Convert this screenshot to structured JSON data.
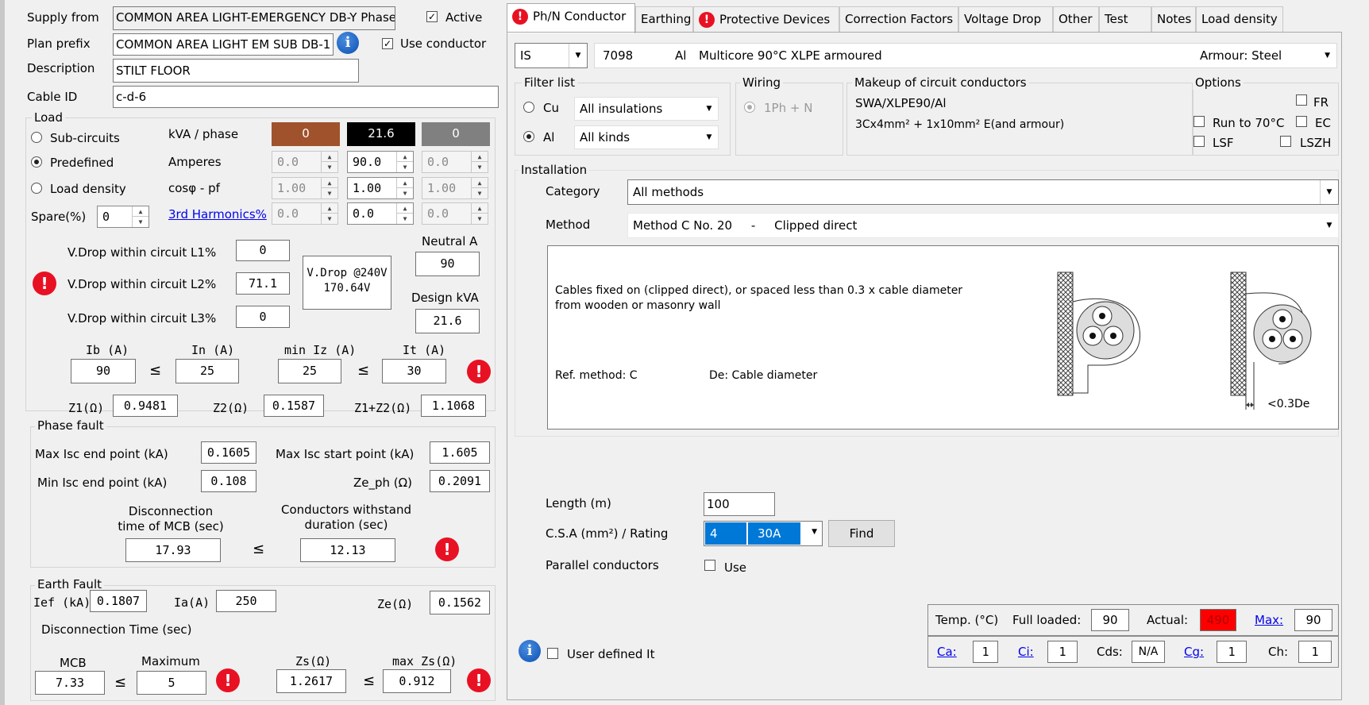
{
  "header": {
    "supply_from_label": "Supply from",
    "supply_from_value": "COMMON AREA LIGHT-EMERGENCY DB-Y Phase",
    "active_label": "Active",
    "plan_prefix_label": "Plan prefix",
    "plan_prefix_value": "COMMON AREA LIGHT EM SUB DB-1",
    "use_conductor_label": "Use conductor",
    "description_label": "Description",
    "description_value": "STILT FLOOR",
    "cable_id_label": "Cable ID",
    "cable_id_value": "c-d-6"
  },
  "load": {
    "title": "Load",
    "radio_sub": "Sub-circuits",
    "radio_predef": "Predefined",
    "radio_density": "Load density",
    "spare_label": "Spare(%)",
    "spare_value": "0",
    "kva_label": "kVA / phase",
    "amps_label": "Amperes",
    "pf_label": "cosφ - pf",
    "harm_label": "3rd Harmonics%",
    "kva": [
      "0",
      "21.6",
      "0"
    ],
    "kva_colors": [
      "#a0522d",
      "#000000",
      "#808080"
    ],
    "amps": [
      "0.0",
      "90.0",
      "0.0"
    ],
    "pf": [
      "1.00",
      "1.00",
      "1.00"
    ],
    "harm": [
      "0.0",
      "0.0",
      "0.0"
    ]
  },
  "vdrop": {
    "l1_label": "V.Drop within circuit L1%",
    "l1_value": "0",
    "l2_label": "V.Drop within circuit L2%",
    "l2_value": "71.1",
    "l3_label": "V.Drop within circuit L3%",
    "l3_value": "0",
    "at240_line1": "V.Drop @240V",
    "at240_line2": "170.64V",
    "neutral_label": "Neutral A",
    "neutral_value": "90",
    "design_kva_label": "Design kVA",
    "design_kva_value": "21.6"
  },
  "currents": {
    "ib_label": "Ib (A)",
    "ib_value": "90",
    "in_label": "In (A)",
    "in_value": "25",
    "miniz_label": "min Iz (A)",
    "miniz_value": "25",
    "it_label": "It (A)",
    "it_value": "30",
    "le": "≤",
    "z1_label": "Z1(Ω)",
    "z1_value": "0.9481",
    "z2_label": "Z2(Ω)",
    "z2_value": "0.1587",
    "z12_label": "Z1+Z2(Ω)",
    "z12_value": "1.1068"
  },
  "phase_fault": {
    "title": "Phase fault",
    "max_end_label": "Max Isc end point (kA)",
    "max_end_value": "0.1605",
    "max_start_label": "Max Isc start point (kA)",
    "max_start_value": "1.605",
    "min_end_label": "Min Isc end point (kA)",
    "min_end_value": "0.108",
    "zeph_label": "Ze_ph (Ω)",
    "zeph_value": "0.2091",
    "disc_line1": "Disconnection",
    "disc_line2": "time of MCB (sec)",
    "disc_value": "17.93",
    "withstand_line1": "Conductors withstand",
    "withstand_line2": "duration (sec)",
    "withstand_value": "12.13"
  },
  "earth_fault": {
    "title": "Earth Fault",
    "ief_label": "Ief (kA)",
    "ief_value": "0.1807",
    "ia_label": "Ia(A)",
    "ia_value": "250",
    "ze_label": "Ze(Ω)",
    "ze_value": "0.1562",
    "disc_time_label": "Disconnection Time (sec)",
    "mcb_label": "MCB",
    "mcb_value": "7.33",
    "max_label": "Maximum",
    "max_value": "5",
    "zs_label": "Zs(Ω)",
    "zs_value": "1.2617",
    "maxzs_label": "max Zs(Ω)",
    "maxzs_value": "0.912"
  },
  "tabs": [
    "Ph/N Conductor",
    "Earthing",
    "Protective Devices",
    "Correction Factors",
    "Voltage Drop",
    "Other",
    "Test",
    "Notes",
    "Load density"
  ],
  "cable": {
    "standard": "IS",
    "code": "7098",
    "material": "Al",
    "desc": "Multicore 90°C XLPE armoured",
    "armour": "Armour: Steel"
  },
  "filter": {
    "title": "Filter list",
    "cu_label": "Cu",
    "al_label": "Al",
    "insulations": "All insulations",
    "kinds": "All kinds"
  },
  "wiring": {
    "title": "Wiring",
    "option": "1Ph + N"
  },
  "makeup": {
    "title": "Makeup of circuit conductors",
    "line1": "SWA/XLPE90/Al",
    "line2": "3Cx4mm² + 1x10mm² E(and armour)"
  },
  "options": {
    "title": "Options",
    "fr": "FR",
    "run70": "Run to 70°C",
    "ec": "EC",
    "lsf": "LSF",
    "lszh": "LSZH"
  },
  "installation": {
    "title": "Installation",
    "category_label": "Category",
    "category_value": "All methods",
    "method_label": "Method",
    "method_value": "Method C No. 20     -     Clipped direct",
    "desc_line1": "Cables fixed on (clipped direct), or spaced less than 0.3 x cable diameter",
    "desc_line2": "from wooden or masonry wall",
    "ref_method": "Ref. method: C",
    "de_text": "De: Cable diameter",
    "dim_label": "<0.3De"
  },
  "sizing": {
    "length_label": "Length (m)",
    "length_value": "100",
    "csa_label": "C.S.A (mm²) / Rating",
    "csa_value": "4",
    "rating_value": "30A",
    "find_label": "Find",
    "parallel_label": "Parallel conductors",
    "use_label": "Use"
  },
  "temperature": {
    "temp_label": "Temp. (°C)",
    "full_label": "Full loaded:",
    "full_value": "90",
    "actual_label": "Actual:",
    "actual_value": "490",
    "max_label": "Max:",
    "max_value": "90",
    "actual_color": "#ff0000"
  },
  "factors": {
    "ca_label": "Ca:",
    "ca_value": "1",
    "ci_label": "Ci:",
    "ci_value": "1",
    "cds_label": "Cds:",
    "cds_value": "N/A",
    "cg_label": "Cg:",
    "cg_value": "1",
    "ch_label": "Ch:",
    "ch_value": "1"
  },
  "footer": {
    "user_defined_label": "User defined It"
  }
}
